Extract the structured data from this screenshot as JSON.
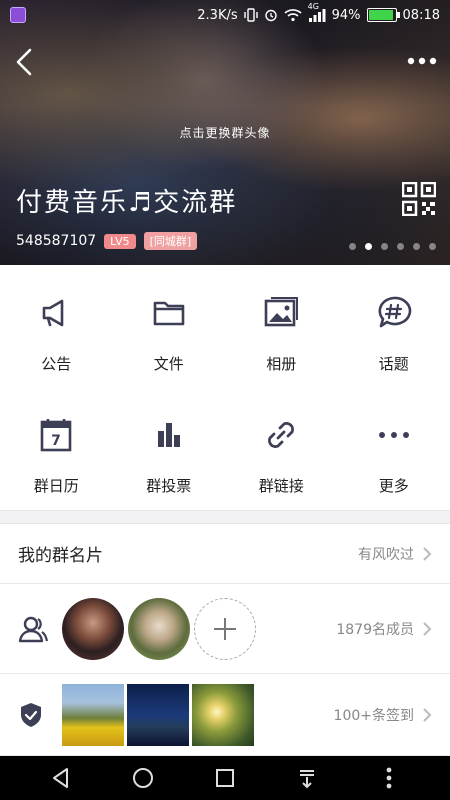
{
  "status_bar": {
    "net_speed": "2.3K/s",
    "network_type": "4G",
    "battery_percent": "94%",
    "battery_level": 0.94,
    "time": "08:18",
    "icons": [
      "app-notification-icon",
      "vibrate-icon",
      "alarm-icon",
      "wifi-icon",
      "signal-icon",
      "battery-icon"
    ]
  },
  "header": {
    "change_avatar_hint": "点击更换群头像",
    "group_name": "付费音乐♬交流群",
    "group_id": "548587107",
    "level_badge": "LV5",
    "city_badge": "[同城群]",
    "carousel_pages": 6,
    "carousel_active_index": 1,
    "icons": [
      "back-arrow-icon",
      "more-dots-icon",
      "qr-code-icon"
    ]
  },
  "features": [
    {
      "label": "公告",
      "icon": "megaphone-icon"
    },
    {
      "label": "文件",
      "icon": "folder-icon"
    },
    {
      "label": "相册",
      "icon": "photo-album-icon"
    },
    {
      "label": "话题",
      "icon": "hashtag-bubble-icon"
    },
    {
      "label": "群日历",
      "icon": "calendar-icon"
    },
    {
      "label": "群投票",
      "icon": "vote-bars-icon"
    },
    {
      "label": "群链接",
      "icon": "link-icon"
    },
    {
      "label": "更多",
      "icon": "more-dots-icon"
    }
  ],
  "calendar_day": "7",
  "group_card": {
    "label": "我的群名片",
    "value": "有风吹过"
  },
  "members": {
    "count_text": "1879名成员",
    "icon": "members-icon"
  },
  "checkin": {
    "count_text": "100+条签到",
    "icon": "checkmark-shield-icon"
  },
  "colors": {
    "accent_badge": "#f08a8a",
    "icon_color": "#3c3f55",
    "separator": "#f2f2f5",
    "navbar": "#000000"
  }
}
